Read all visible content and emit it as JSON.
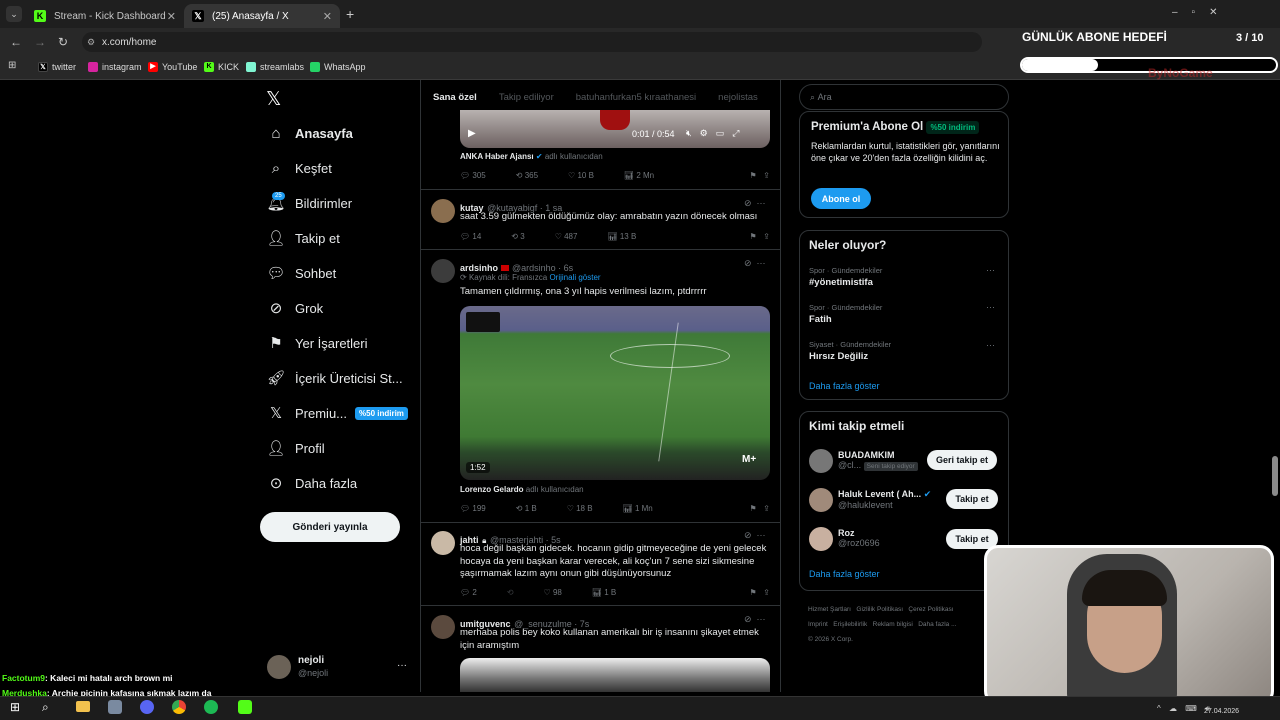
{
  "browser": {
    "tabs": [
      {
        "label": "Stream - Kick Dashboard"
      },
      {
        "label": "(25) Anasayfa / X"
      }
    ],
    "url": "x.com/home",
    "bookmarks": [
      {
        "label": "twitter"
      },
      {
        "label": "instagram"
      },
      {
        "label": "YouTube"
      },
      {
        "label": "KICK"
      },
      {
        "label": "streamlabs"
      },
      {
        "label": "WhatsApp"
      }
    ]
  },
  "overlay": {
    "goal_title": "GÜNLÜK ABONE HEDEFİ",
    "goal_count": "3 / 10",
    "goal_progress": 0.3,
    "watermark": "ByNoGame"
  },
  "nav": {
    "items": [
      {
        "label": "Anasayfa",
        "icon": "home-icon"
      },
      {
        "label": "Keşfet",
        "icon": "search-icon"
      },
      {
        "label": "Bildirimler",
        "icon": "bell-icon",
        "count": "25"
      },
      {
        "label": "Takip et",
        "icon": "person-add-icon"
      },
      {
        "label": "Sohbet",
        "icon": "chat-icon"
      },
      {
        "label": "Grok",
        "icon": "grok-icon"
      },
      {
        "label": "Yer İşaretleri",
        "icon": "bookmark-icon"
      },
      {
        "label": "İçerik Üreticisi St...",
        "icon": "rocket-icon"
      },
      {
        "label": "Premiu...",
        "icon": "x-logo-icon",
        "badge": "%50 indirim"
      },
      {
        "label": "Profil",
        "icon": "person-icon"
      },
      {
        "label": "Daha fazla",
        "icon": "more-circle-icon"
      }
    ],
    "post_button": "Gönderi yayınla",
    "account": {
      "name": "nejoli",
      "handle": "@nejoli"
    }
  },
  "feed": {
    "tabs": [
      "Sana özel",
      "Takip ediliyor",
      "batuhanfurkan5 kıraathanesi",
      "nejolistas"
    ],
    "video1": {
      "time": "0:01 / 0:54",
      "source": "ANKA Haber Ajansı",
      "source_suffix": "adlı kullanıcıdan",
      "replies": "305",
      "reposts": "365",
      "likes": "10 B",
      "views": "2 Mn"
    },
    "tweets": [
      {
        "name": "kutay",
        "handle": "@kutayabigf · 1 sa",
        "text": "saat 3.59 gülmekten öldüğümüz olay: amrabatın yazın dönecek olması",
        "replies": "14",
        "reposts": "3",
        "likes": "487",
        "views": "13 B"
      },
      {
        "name": "ardsinho",
        "handle": "@ardsinho · 6s",
        "lang": "Kaynak dili: Fransızca",
        "show_original": "Orijinali göster",
        "text": "Tamamen çıldırmış, ona 3 yıl hapis verilmesi lazım, ptdrrrrr",
        "video_duration": "1:52",
        "video_watermark": "M+",
        "source": "Lorenzo Gelardo",
        "source_suffix": "adlı kullanıcıdan",
        "replies": "199",
        "reposts": "1 B",
        "likes": "18 B",
        "views": "1 Mn"
      },
      {
        "name": "jahti",
        "handle": "@masterjahti · 5s",
        "text": "hoca değil başkan gidecek. hocanın gidip gitmeyeceğine de yeni gelecek hocaya da yeni başkan karar verecek, ali koç'un 7 sene sizi sikmesine şaşırmamak lazım aynı onun gibi düşünüyorsunuz",
        "replies": "2",
        "reposts": "",
        "likes": "98",
        "views": "1 B"
      },
      {
        "name": "umitguvenc",
        "handle": "@_senuzulme · 7s",
        "text": "merhaba polis bey koko kullanan amerikalı bir iş insanını şikayet etmek için aramıştım"
      }
    ]
  },
  "right": {
    "search_placeholder": "Ara",
    "premium": {
      "title": "Premium'a Abone Ol",
      "badge": "%50 indirim",
      "text": "Reklamlardan kurtul, istatistikleri gör, yanıtlarını öne çıkar ve 20'den fazla özelliğin kilidini aç.",
      "button": "Abone ol"
    },
    "trends": {
      "title": "Neler oluyor?",
      "items": [
        {
          "category": "Spor · Gündemdekiler",
          "topic": "#yönetimistifa"
        },
        {
          "category": "Spor · Gündemdekiler",
          "topic": "Fatih"
        },
        {
          "category": "Siyaset · Gündemdekiler",
          "topic": "Hırsız Değiliz"
        }
      ],
      "more": "Daha fazla göster"
    },
    "who": {
      "title": "Kimi takip etmeli",
      "items": [
        {
          "name": "BUADAMKIM",
          "handle": "@cl...",
          "note": "Seni takip ediyor",
          "button": "Geri takip et"
        },
        {
          "name": "Haluk Levent ( Ah...",
          "handle": "@haluklevent",
          "button": "Takip et"
        },
        {
          "name": "Roz",
          "handle": "@roz0696",
          "button": "Takip et"
        }
      ],
      "more": "Daha fazla göster"
    },
    "footer": [
      "Hizmet Şartları",
      "Gizlilik Politikası",
      "Çerez Politikası",
      "Imprint",
      "Erişilebilirlik",
      "Reklam bilgisi",
      "Daha fazla ...",
      "© 2026 X Corp."
    ]
  },
  "chat": [
    {
      "user": "Factotum9",
      "text": ": Kaleci mi hatalı arch brown mi"
    },
    {
      "user": "Merdushka",
      "text": ": Archie piçinin kafasına sıkmak lazım da"
    }
  ],
  "taskbar": {
    "date": "27.04.2026"
  }
}
